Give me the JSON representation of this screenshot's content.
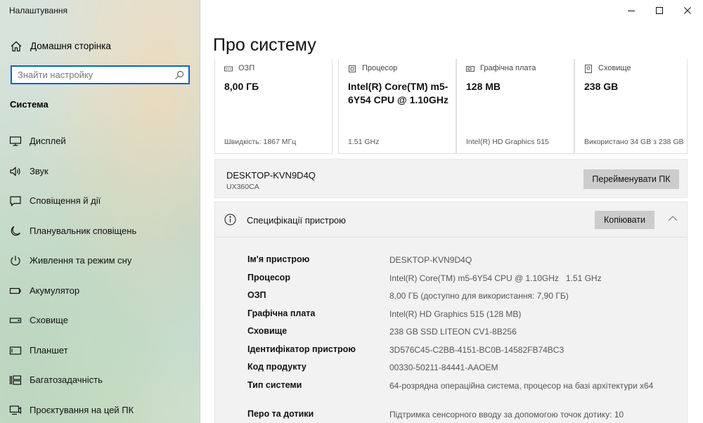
{
  "window": {
    "title": "Налаштування"
  },
  "sidebar": {
    "home_label": "Домашня сторінка",
    "search_placeholder": "Знайти настройку",
    "section_title": "Система",
    "items": [
      {
        "label": "Дисплей",
        "icon": "display-icon"
      },
      {
        "label": "Звук",
        "icon": "speaker-icon"
      },
      {
        "label": "Сповіщення й дії",
        "icon": "notification-icon"
      },
      {
        "label": "Планувальник сповіщень",
        "icon": "moon-icon"
      },
      {
        "label": "Живлення та режим сну",
        "icon": "power-icon"
      },
      {
        "label": "Акумулятор",
        "icon": "battery-icon"
      },
      {
        "label": "Сховище",
        "icon": "storage-icon"
      },
      {
        "label": "Планшет",
        "icon": "tablet-icon"
      },
      {
        "label": "Багатозадачність",
        "icon": "multitasking-icon"
      },
      {
        "label": "Проєктування на цей ПК",
        "icon": "projection-icon"
      }
    ]
  },
  "main": {
    "title": "Про систему",
    "cards": [
      {
        "label": "ОЗП",
        "value": "8,00 ГБ",
        "sub": "Швидкість: 1867 МГц",
        "icon": "ram-icon"
      },
      {
        "label": "Процесор",
        "value": "Intel(R) Core(TM) m5-6Y54 CPU @ 1.10GHz",
        "sub": "1.51 GHz",
        "icon": "cpu-icon"
      },
      {
        "label": "Графічна плата",
        "value": "128 MB",
        "sub": "Intel(R) HD Graphics 515",
        "icon": "gpu-icon"
      },
      {
        "label": "Сховище",
        "value": "238 GB",
        "sub": "Використано 34 GB з 238 GB",
        "icon": "storage-icon"
      }
    ],
    "pc": {
      "name": "DESKTOP-KVN9D4Q",
      "model": "UX360CA",
      "rename_label": "Перейменувати ПК"
    },
    "specs": {
      "title": "Специфікації пристрою",
      "copy_label": "Копіювати",
      "rows": [
        {
          "key": "Ім'я пристрою",
          "value": "DESKTOP-KVN9D4Q"
        },
        {
          "key": "Процесор",
          "value": "Intel(R) Core(TM) m5-6Y54 CPU @ 1.10GHz   1.51 GHz"
        },
        {
          "key": "ОЗП",
          "value": "8,00 ГБ (доступно для використання: 7,90 ГБ)"
        },
        {
          "key": "Графічна плата",
          "value": "Intel(R) HD Graphics 515 (128 MB)"
        },
        {
          "key": "Сховище",
          "value": "238 GB SSD LITEON CV1-8B256"
        },
        {
          "key": "Ідентифікатор пристрою",
          "value": "3D576C45-C2BB-4151-BC0B-14582FB74BC3"
        },
        {
          "key": "Код продукту",
          "value": "00330-50211-84441-AAOEM"
        },
        {
          "key": "Тип системи",
          "value": "64-розрядна операційна система, процесор на базі архітектури x64"
        },
        {
          "key": "Перо та дотики",
          "value": "Підтримка сенсорного вводу за допомогою точок дотику: 10"
        }
      ]
    }
  },
  "colors": {
    "accent": "#0b64c0",
    "button_bg": "#cccccc",
    "panel_bg": "#f2f2f2"
  }
}
